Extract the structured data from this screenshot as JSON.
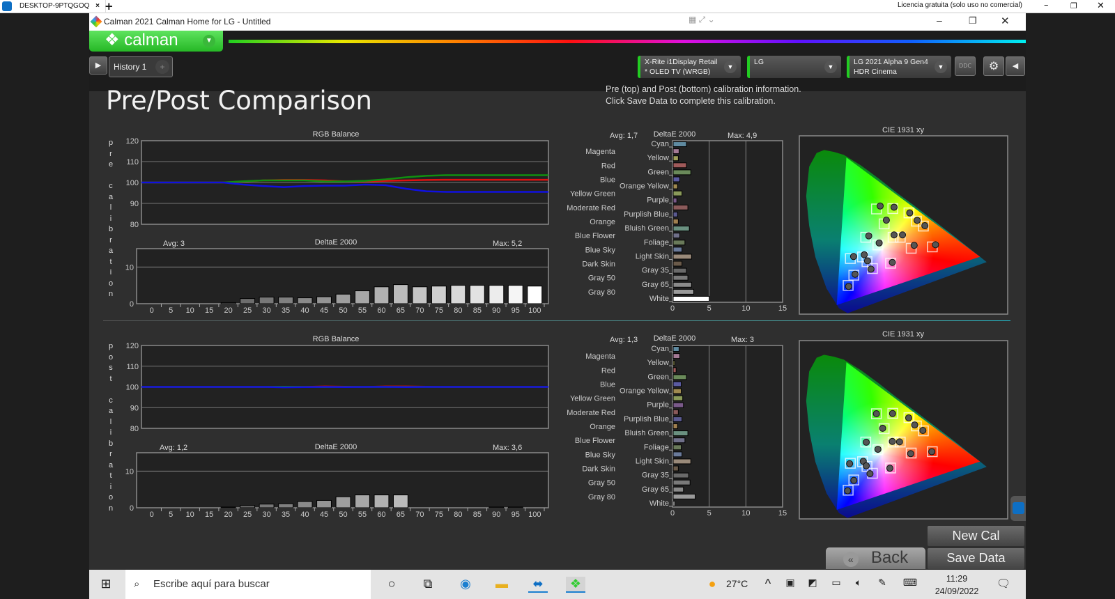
{
  "remote_bar": {
    "tab_label": "DESKTOP-9PTQGOQ",
    "close": "×",
    "new_tab": "+",
    "license": "Licencia gratuita (solo uso no comercial)"
  },
  "window": {
    "title": "Calman 2021 Calman Home for LG  - Untitled",
    "logo_text": "calman",
    "history_tab": "History 1",
    "add_tab": "+"
  },
  "devices": [
    {
      "line1": "X-Rite i1Display Retail",
      "line2": "* OLED TV (WRGB)"
    },
    {
      "line1": "LG",
      "line2": ""
    },
    {
      "line1": "LG 2021 Alpha 9 Gen4",
      "line2": "HDR Cinema"
    }
  ],
  "ddc_label": "DDC",
  "page": {
    "title": "Pre/Post Comparison",
    "info_line1": "Pre (top) and Post (bottom) calibration information.",
    "info_line2": "Click Save Data to complete this calibration.",
    "pre_label": [
      "p",
      "r",
      "e",
      "",
      "c",
      "a",
      "l",
      "i",
      "b",
      "r",
      "a",
      "t",
      "i",
      "o",
      "n"
    ],
    "post_label": [
      "p",
      "o",
      "s",
      "t",
      "",
      "c",
      "a",
      "l",
      "i",
      "b",
      "r",
      "a",
      "t",
      "i",
      "o",
      "n"
    ]
  },
  "buttons": {
    "new_cal": "New Cal",
    "save_data": "Save Data",
    "back": "Back"
  },
  "taskbar": {
    "search_placeholder": "Escribe aquí para buscar",
    "weather": "27°C",
    "time": "11:29",
    "date": "24/09/2022"
  },
  "colors": {
    "accent_green": "#2ccc2c",
    "background": "#2f2f2f",
    "plot_bg": "#222222",
    "red": "#e01010",
    "green": "#109010",
    "blue": "#1010e0"
  },
  "chart_data": [
    {
      "id": "pre_rgb",
      "type": "line",
      "title": "RGB Balance",
      "ylim": [
        80,
        120
      ],
      "yticks": [
        80,
        90,
        100,
        110,
        120
      ],
      "grid": true,
      "x": [
        0,
        5,
        10,
        15,
        20,
        25,
        30,
        35,
        40,
        45,
        50,
        55,
        60,
        65,
        70,
        75,
        80,
        85,
        90,
        95,
        100
      ],
      "series": [
        {
          "color": "#e01010",
          "values": [
            100,
            100,
            100,
            100,
            100,
            100.5,
            101,
            101.2,
            101.2,
            101,
            100.5,
            100.5,
            100.8,
            101,
            101.2,
            101.3,
            101.3,
            101.3,
            101.3,
            101.3,
            101.3
          ]
        },
        {
          "color": "#109010",
          "values": [
            100,
            100,
            100,
            100,
            100,
            100.6,
            101,
            101,
            101,
            100.5,
            100.5,
            100.8,
            101.5,
            102.5,
            103.2,
            103.5,
            103.5,
            103.5,
            103.5,
            103.5,
            103.5
          ]
        },
        {
          "color": "#1010e0",
          "values": [
            100,
            100,
            100,
            100,
            100,
            99,
            98.3,
            97.8,
            98.3,
            98.5,
            98.5,
            99,
            98.7,
            97,
            95.8,
            95.5,
            95.5,
            95.5,
            95.5,
            95.5,
            95.5
          ]
        }
      ]
    },
    {
      "id": "pre_gray_de",
      "type": "bar",
      "title": "DeltaE 2000",
      "avg": "Avg: 3",
      "max": "Max: 5,2",
      "ylim": [
        0,
        15
      ],
      "yticks": [
        0,
        10
      ],
      "categories": [
        "0",
        "5",
        "10",
        "15",
        "20",
        "25",
        "30",
        "35",
        "40",
        "45",
        "50",
        "55",
        "60",
        "65",
        "70",
        "75",
        "80",
        "85",
        "90",
        "95",
        "100"
      ],
      "values": [
        0,
        0,
        0,
        0,
        0.3,
        1.4,
        1.8,
        1.8,
        1.6,
        1.9,
        2.6,
        3.5,
        4.6,
        5.2,
        4.6,
        4.8,
        5.0,
        5.0,
        5.0,
        5.0,
        4.8
      ]
    },
    {
      "id": "pre_color_de",
      "type": "bar",
      "orientation": "horizontal",
      "title": "DeltaE 2000",
      "avg": "Avg: 1,7",
      "max": "Max: 4,9",
      "xlim": [
        0,
        15
      ],
      "xticks": [
        0,
        5,
        10,
        15
      ],
      "categories": [
        "Cyan",
        "Magenta",
        "Yellow",
        "Red",
        "Green",
        "Blue",
        "Orange Yellow",
        "Yellow Green",
        "Purple",
        "Moderate Red",
        "Purplish Blue",
        "Orange",
        "Bluish Green",
        "Blue Flower",
        "Foliage",
        "Blue Sky",
        "Light Skin",
        "Dark Skin",
        "Gray 35",
        "Gray 50",
        "Gray 65",
        "Gray 80",
        "White"
      ],
      "values": [
        1.8,
        0.8,
        0.7,
        1.8,
        2.4,
        0.9,
        0.6,
        1.2,
        0.5,
        2.0,
        0.6,
        0.7,
        2.2,
        0.9,
        1.6,
        1.2,
        2.5,
        1.2,
        1.8,
        2.0,
        2.5,
        2.8,
        4.9
      ]
    },
    {
      "id": "pre_cie",
      "type": "scatter",
      "title": "CIE 1931 xy",
      "targets": [
        [
          0.291,
          0.535
        ],
        [
          0.357,
          0.537
        ],
        [
          0.422,
          0.515
        ],
        [
          0.452,
          0.473
        ],
        [
          0.48,
          0.448
        ],
        [
          0.322,
          0.459
        ],
        [
          0.248,
          0.391
        ],
        [
          0.358,
          0.391
        ],
        [
          0.387,
          0.391
        ],
        [
          0.297,
          0.352
        ],
        [
          0.431,
          0.335
        ],
        [
          0.516,
          0.342
        ],
        [
          0.186,
          0.283
        ],
        [
          0.235,
          0.291
        ],
        [
          0.253,
          0.267
        ],
        [
          0.275,
          0.232
        ],
        [
          0.348,
          0.259
        ],
        [
          0.2,
          0.198
        ],
        [
          0.177,
          0.146
        ]
      ],
      "measured": [
        [
          0.306,
          0.55
        ],
        [
          0.362,
          0.544
        ],
        [
          0.425,
          0.515
        ],
        [
          0.455,
          0.477
        ],
        [
          0.486,
          0.45
        ],
        [
          0.331,
          0.478
        ],
        [
          0.26,
          0.398
        ],
        [
          0.362,
          0.403
        ],
        [
          0.396,
          0.403
        ],
        [
          0.302,
          0.362
        ],
        [
          0.443,
          0.35
        ],
        [
          0.529,
          0.353
        ],
        [
          0.199,
          0.293
        ],
        [
          0.242,
          0.302
        ],
        [
          0.255,
          0.271
        ],
        [
          0.269,
          0.229
        ],
        [
          0.355,
          0.263
        ],
        [
          0.205,
          0.203
        ],
        [
          0.179,
          0.141
        ]
      ]
    },
    {
      "id": "post_rgb",
      "type": "line",
      "title": "RGB Balance",
      "ylim": [
        80,
        120
      ],
      "yticks": [
        80,
        90,
        100,
        110,
        120
      ],
      "grid": true,
      "x": [
        0,
        5,
        10,
        15,
        20,
        25,
        30,
        35,
        40,
        45,
        50,
        55,
        60,
        65,
        70,
        75,
        80,
        85,
        90,
        95,
        100
      ],
      "series": [
        {
          "color": "#e01010",
          "values": [
            100,
            100,
            100,
            100,
            100,
            100,
            100,
            100,
            100,
            100.2,
            100.1,
            100,
            100.2,
            100.2,
            100.1,
            100,
            100,
            100,
            100,
            100,
            100
          ]
        },
        {
          "color": "#109010",
          "values": [
            100,
            100,
            100,
            100,
            100,
            100,
            100,
            100.1,
            100,
            99.9,
            100,
            100,
            100,
            100,
            100,
            100,
            100,
            100,
            100,
            100,
            100
          ]
        },
        {
          "color": "#1010e0",
          "values": [
            100,
            100,
            100,
            100,
            100,
            100,
            100,
            99.8,
            99.9,
            100,
            99.9,
            100,
            100,
            99.9,
            100,
            100,
            100,
            100,
            100,
            100,
            100
          ]
        }
      ]
    },
    {
      "id": "post_gray_de",
      "type": "bar",
      "title": "DeltaE 2000",
      "avg": "Avg: 1,2",
      "max": "Max: 3,6",
      "ylim": [
        0,
        15
      ],
      "yticks": [
        0,
        10
      ],
      "categories": [
        "0",
        "5",
        "10",
        "15",
        "20",
        "25",
        "30",
        "35",
        "40",
        "45",
        "50",
        "55",
        "60",
        "65",
        "70",
        "75",
        "80",
        "85",
        "90",
        "95",
        "100"
      ],
      "values": [
        0,
        0,
        0,
        0,
        0.2,
        0.6,
        1.0,
        1.1,
        1.7,
        2.0,
        3.0,
        3.5,
        3.5,
        3.5,
        0,
        0,
        0,
        0,
        0.2,
        0.2,
        0
      ]
    },
    {
      "id": "post_color_de",
      "type": "bar",
      "orientation": "horizontal",
      "title": "DeltaE 2000",
      "avg": "Avg: 1,3",
      "max": "Max: 3",
      "xlim": [
        0,
        15
      ],
      "xticks": [
        0,
        5,
        10,
        15
      ],
      "categories": [
        "Cyan",
        "Magenta",
        "Yellow",
        "Red",
        "Green",
        "Blue",
        "Orange Yellow",
        "Yellow Green",
        "Purple",
        "Moderate Red",
        "Purplish Blue",
        "Orange",
        "Bluish Green",
        "Blue Flower",
        "Foliage",
        "Blue Sky",
        "Light Skin",
        "Dark Skin",
        "Gray 35",
        "Gray 50",
        "Gray 65",
        "Gray 80",
        "White"
      ],
      "values": [
        0.8,
        0.9,
        0.2,
        0.4,
        1.8,
        1.1,
        1.1,
        1.3,
        1.4,
        0.7,
        1.2,
        0.6,
        2.0,
        1.6,
        1.1,
        1.2,
        2.4,
        0.7,
        2.1,
        2.3,
        1.4,
        3.0,
        0.2
      ]
    },
    {
      "id": "post_cie",
      "type": "scatter",
      "title": "CIE 1931 xy",
      "targets": [
        [
          0.291,
          0.535
        ],
        [
          0.357,
          0.537
        ],
        [
          0.422,
          0.515
        ],
        [
          0.452,
          0.473
        ],
        [
          0.48,
          0.448
        ],
        [
          0.322,
          0.459
        ],
        [
          0.248,
          0.391
        ],
        [
          0.358,
          0.391
        ],
        [
          0.387,
          0.391
        ],
        [
          0.297,
          0.352
        ],
        [
          0.431,
          0.335
        ],
        [
          0.516,
          0.342
        ],
        [
          0.186,
          0.283
        ],
        [
          0.235,
          0.291
        ],
        [
          0.253,
          0.267
        ],
        [
          0.275,
          0.232
        ],
        [
          0.348,
          0.259
        ],
        [
          0.2,
          0.198
        ],
        [
          0.177,
          0.146
        ]
      ],
      "measured": [
        [
          0.291,
          0.535
        ],
        [
          0.356,
          0.536
        ],
        [
          0.421,
          0.514
        ],
        [
          0.445,
          0.478
        ],
        [
          0.478,
          0.45
        ],
        [
          0.316,
          0.461
        ],
        [
          0.25,
          0.39
        ],
        [
          0.355,
          0.394
        ],
        [
          0.384,
          0.392
        ],
        [
          0.297,
          0.354
        ],
        [
          0.429,
          0.332
        ],
        [
          0.514,
          0.342
        ],
        [
          0.183,
          0.281
        ],
        [
          0.238,
          0.293
        ],
        [
          0.25,
          0.27
        ],
        [
          0.265,
          0.23
        ],
        [
          0.345,
          0.258
        ],
        [
          0.2,
          0.196
        ],
        [
          0.175,
          0.143
        ]
      ]
    }
  ],
  "color_patch_fills": [
    "#5f8aa0",
    "#a47a95",
    "#a0a05a",
    "#a05a5a",
    "#6a8a5a",
    "#5a5aa0",
    "#a08a50",
    "#8a9a5a",
    "#7a5a8a",
    "#8a5a5a",
    "#5a5a90",
    "#a08050",
    "#6a9080",
    "#70708a",
    "#6a7a5a",
    "#6a7a9a",
    "#9a8a7a",
    "#6a5a4a",
    "#6a6a6a",
    "#7a7a7a",
    "#8a8a8a",
    "#9a9a9a",
    "#ffffff"
  ]
}
